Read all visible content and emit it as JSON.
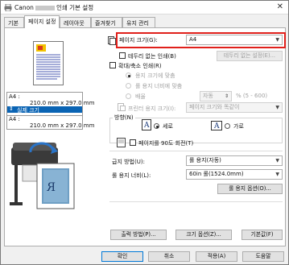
{
  "window": {
    "title_prefix": "Canon",
    "title_suffix": "인쇄 기본 설정",
    "close_glyph": "✕"
  },
  "tabs": [
    {
      "label": "기본"
    },
    {
      "label": "페이지 설정"
    },
    {
      "label": "레이아웃"
    },
    {
      "label": "즐겨찾기"
    },
    {
      "label": "유지 관리"
    }
  ],
  "preview": {
    "info_lines": [
      "A4 :",
      "210.0 mm x 297.0 mm"
    ],
    "size_mode": "실제 크기",
    "info_lines_2": [
      "A4 :",
      "210.0 mm x 297.0 mm"
    ],
    "printer_letter": "R"
  },
  "page_size": {
    "label": "페이지 크기(G):",
    "value": "A4"
  },
  "borderless": {
    "label": "테두리 없는 인쇄(B)",
    "settings_button": "테두리 없는 설정(E)..."
  },
  "scaling": {
    "label": "확대/축소 인쇄(R)",
    "option_fit": "용지 크기에 맞춤",
    "option_roll": "롤 용지 너비에 맞춤",
    "option_scale": "배율",
    "scale_value": "자동",
    "scale_range": "% (5 - 600)",
    "printer_paper_label": "프린터 용지 크기(I):",
    "printer_paper_value": "페이지 크기와 똑같이"
  },
  "orientation": {
    "label": "방향(N)",
    "portrait": "세로",
    "landscape": "가로",
    "rotate_label": "페이지를 90도 회전(T)"
  },
  "paper_source": {
    "label": "급지 방법(U):",
    "value": "롤 용지(자동)"
  },
  "roll_width": {
    "label": "롤 용지 너비(L):",
    "value": "60in 롤(1524.0mm)",
    "options_button": "롤 용지 옵션(O)..."
  },
  "bottom_buttons": {
    "output": "출력 방법(P)...",
    "size_options": "크기 옵션(Z)...",
    "defaults": "기본값(F)"
  },
  "dialog_buttons": {
    "ok": "확인",
    "cancel": "취소",
    "apply": "적용(A)",
    "help": "도움말"
  }
}
